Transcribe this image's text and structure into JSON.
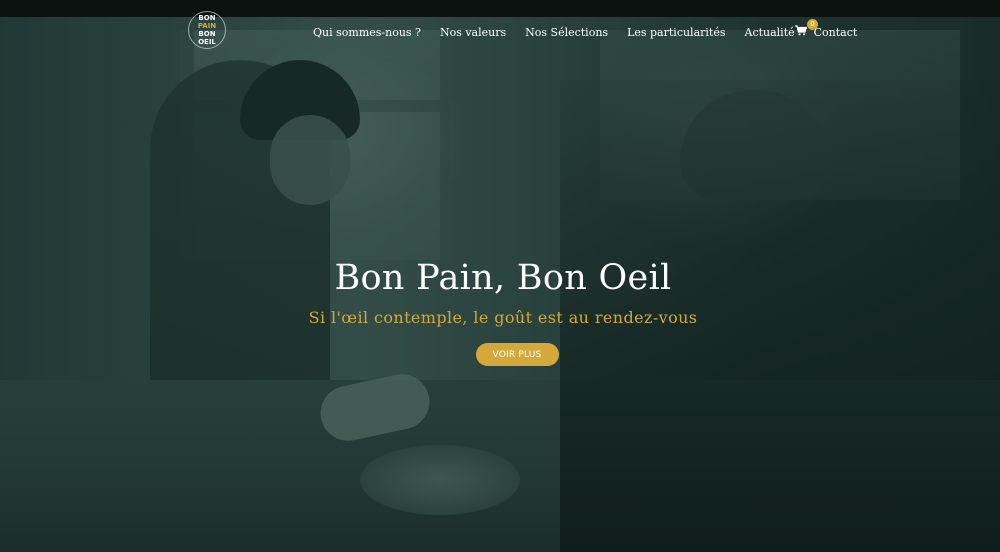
{
  "brand": {
    "logo_lines": [
      "BON",
      "PAIN",
      "BON",
      "OEIL"
    ],
    "logo_name": "Bon Pain Bon Oeil"
  },
  "nav": {
    "items": [
      {
        "label": "Qui sommes-nous ?"
      },
      {
        "label": "Nos valeurs"
      },
      {
        "label": "Nos Sélections"
      },
      {
        "label": "Les particularités"
      },
      {
        "label": "Actualité"
      },
      {
        "label": "Contact"
      }
    ],
    "cart": {
      "icon": "shopping-cart-icon",
      "count": "0"
    }
  },
  "hero": {
    "title": "Bon Pain, Bon Oeil",
    "subtitle": "Si l'œil contemple, le goût est au rendez-vous",
    "cta_label": "VOIR PLUS"
  },
  "colors": {
    "accent": "#d4a93a",
    "topbar": "#0b1210",
    "text": "#ffffff"
  }
}
